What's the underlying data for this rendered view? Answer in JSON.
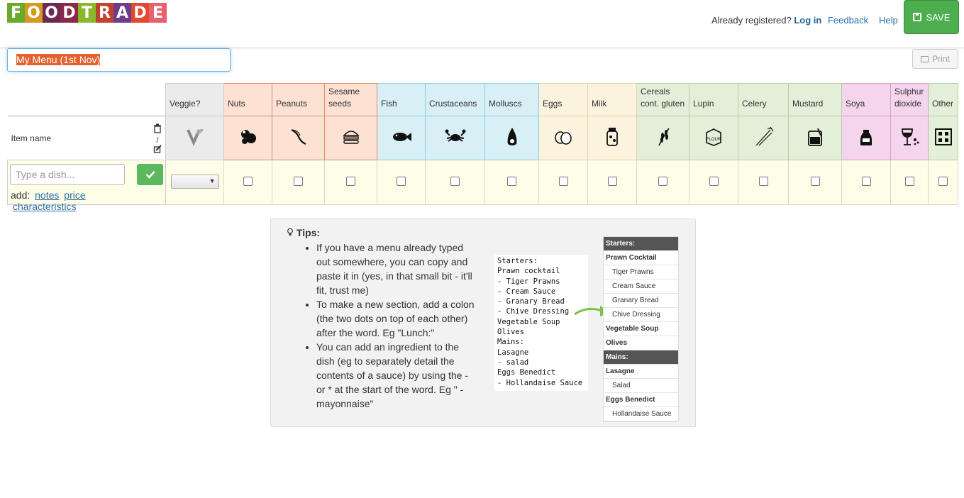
{
  "header": {
    "logo_letters": [
      "F",
      "O",
      "O",
      "D",
      "T",
      "R",
      "A",
      "D",
      "E"
    ],
    "logo_colors": [
      "#6aaa2a",
      "#d49b1e",
      "#6b2a53",
      "#8a2a4b",
      "#8ab82c",
      "#c2432c",
      "#6b3d8a",
      "#e2492e",
      "#e8606e"
    ],
    "already_registered": "Already registered?",
    "login": "Log in",
    "feedback": "Feedback",
    "help": "Help",
    "save": "SAVE"
  },
  "menu": {
    "title": "My Menu (1st Nov)",
    "print": "Print"
  },
  "table": {
    "item_name": "Item name",
    "dish_placeholder": "Type a dish...",
    "add_label": "add:",
    "add_links": [
      "notes",
      "price",
      "characteristics"
    ],
    "columns": [
      {
        "label": "Veggie?",
        "icon": "leaf-v-icon",
        "bg": "#ebebeb",
        "border": "#cccccc"
      },
      {
        "label": "Nuts",
        "icon": "nuts-icon",
        "bg": "#fde1d3",
        "border": "#d98e6c"
      },
      {
        "label": "Peanuts",
        "icon": "peanut-icon",
        "bg": "#fde1d3",
        "border": "#d98e6c"
      },
      {
        "label": "Sesame seeds",
        "icon": "burger-bun-icon",
        "bg": "#fde1d3",
        "border": "#d98e6c"
      },
      {
        "label": "Fish",
        "icon": "fish-icon",
        "bg": "#d7eff5",
        "border": "#8dcfe0"
      },
      {
        "label": "Crustaceans",
        "icon": "crab-icon",
        "bg": "#d7eff5",
        "border": "#8dcfe0"
      },
      {
        "label": "Molluscs",
        "icon": "shell-icon",
        "bg": "#d7eff5",
        "border": "#8dcfe0"
      },
      {
        "label": "Eggs",
        "icon": "eggs-icon",
        "bg": "#fbf3de",
        "border": "#e3d3a3"
      },
      {
        "label": "Milk",
        "icon": "milk-bottle-icon",
        "bg": "#fbf3de",
        "border": "#e3d3a3"
      },
      {
        "label": "Cereals cont. gluten",
        "icon": "wheat-icon",
        "bg": "#e4efd9",
        "border": "#b7cf9c"
      },
      {
        "label": "Lupin",
        "icon": "lupin-box-icon",
        "bg": "#e4efd9",
        "border": "#b7cf9c"
      },
      {
        "label": "Celery",
        "icon": "celery-icon",
        "bg": "#e4efd9",
        "border": "#b7cf9c"
      },
      {
        "label": "Mustard",
        "icon": "mustard-jar-icon",
        "bg": "#e4efd9",
        "border": "#b7cf9c"
      },
      {
        "label": "Soya",
        "icon": "soy-sauce-icon",
        "bg": "#f4d5ed",
        "border": "#d79cc6"
      },
      {
        "label": "Sulphur dioxide",
        "icon": "wine-glass-icon",
        "bg": "#f4d5ed",
        "border": "#d79cc6"
      },
      {
        "label": "Other",
        "icon": "grid-dots-icon",
        "bg": "#e4efd9",
        "border": "#b7cf9c"
      }
    ]
  },
  "tips": {
    "title": "Tips:",
    "items": [
      "If you have a menu already typed out somewhere, you can copy and paste it in (yes, in that small bit - it'll fit, trust me)",
      "To make a new section, add a colon (the two dots on top of each other) after the word. Eg \"Lunch:\"",
      "You can add an ingredient to the dish (eg to separately detail the contents of a sauce) by using the - or * at the start of the word. Eg \" - mayonnaise\""
    ],
    "example_text": "Starters:\nPrawn cocktail\n- Tiger Prawns\n- Cream Sauce\n- Granary Bread\n- Chive Dressing\nVegetable Soup\nOlives\nMains:\nLasagne\n- salad\nEggs Benedict\n- Hollandaise Sauce",
    "preview_rows": [
      {
        "text": "Starters:",
        "type": "sec"
      },
      {
        "text": "Prawn Cocktail",
        "type": "dish"
      },
      {
        "text": "Tiger Prawns",
        "type": "ing"
      },
      {
        "text": "Cream Sauce",
        "type": "ing"
      },
      {
        "text": "Granary Bread",
        "type": "ing"
      },
      {
        "text": "Chive Dressing",
        "type": "ing"
      },
      {
        "text": "Vegetable Soup",
        "type": "dish"
      },
      {
        "text": "Olives",
        "type": "dish"
      },
      {
        "text": "Mains:",
        "type": "sec"
      },
      {
        "text": "Lasagne",
        "type": "dish"
      },
      {
        "text": "Salad",
        "type": "ing"
      },
      {
        "text": "Eggs Benedict",
        "type": "dish"
      },
      {
        "text": "Hollandaise Sauce",
        "type": "ing"
      }
    ]
  }
}
